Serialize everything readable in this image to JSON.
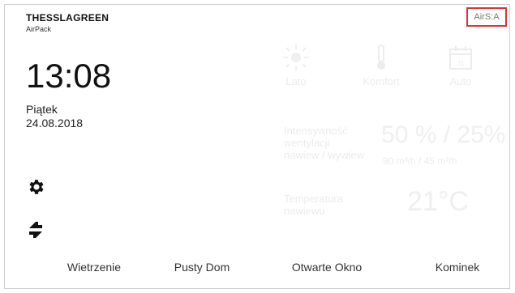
{
  "header": {
    "brand": "THESSLAGREEN",
    "product": "AirPack",
    "status": "AirS:A"
  },
  "clock": {
    "time": "13:08",
    "day": "Piątek",
    "date": "24.08.2018"
  },
  "modes": [
    {
      "label": "Lato",
      "icon": "sun-icon"
    },
    {
      "label": "Komfort",
      "icon": "thermometer-icon"
    },
    {
      "label": "Auto",
      "icon": "calendar-icon"
    }
  ],
  "ventilation": {
    "label_line1": "Intensywność",
    "label_line2": "wentylacji",
    "label_line3": "nawiew / wywiew",
    "value": "50 % / 25%",
    "flow": "90 m³/h / 45 m³/h"
  },
  "supply_temp": {
    "label_line1": "Temperatura",
    "label_line2": "nawiewu",
    "value": "21°C"
  },
  "calendar_day": "31",
  "bottom_nav": [
    "Wietrzenie",
    "Pusty Dom",
    "Otwarte Okno",
    "Kominek"
  ],
  "icons": {
    "settings": "gear-icon",
    "sync": "sync-icon"
  },
  "colors": {
    "status_border": "#d93737"
  }
}
